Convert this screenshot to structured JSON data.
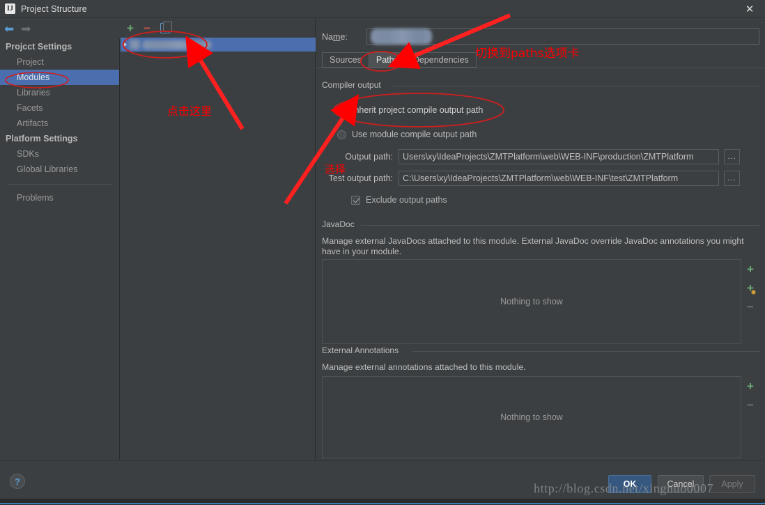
{
  "window": {
    "title": "Project Structure",
    "app_icon": "intellij-idea-icon",
    "close_icon": "close-icon"
  },
  "nav": {
    "back_icon": "arrow-left-icon",
    "forward_icon": "arrow-right-icon"
  },
  "sidebar": {
    "groups": [
      {
        "label": "Projcct Settings",
        "items": [
          {
            "label": "Project",
            "selected": false
          },
          {
            "label": "Modules",
            "selected": true
          },
          {
            "label": "Libraries",
            "selected": false
          },
          {
            "label": "Facets",
            "selected": false
          },
          {
            "label": "Artifacts",
            "selected": false
          }
        ]
      },
      {
        "label": "Platform Settings",
        "items": [
          {
            "label": "SDKs",
            "selected": false
          },
          {
            "label": "Global Libraries",
            "selected": false
          }
        ]
      }
    ],
    "problems": "Problems"
  },
  "modules_panel": {
    "toolbar": {
      "add_icon": "plus-icon",
      "remove_icon": "minus-icon",
      "copy_icon": "copy-icon"
    },
    "selected_row_label": "",
    "selected_row_redacted": true
  },
  "form": {
    "name_label": "Name:",
    "name_value": "",
    "name_redacted": true,
    "tabs": [
      {
        "label": "Sources",
        "active": false
      },
      {
        "label": "Paths",
        "active": true
      },
      {
        "label": "Dependencies",
        "active": false
      }
    ],
    "compiler_output": {
      "group_title": "Compiler output",
      "inherit_option": "Inherit project compile output path",
      "inherit_selected": true,
      "module_option": "Use module compile output path",
      "module_selected": false,
      "output_path_label": "Output path:",
      "output_path_value": "Users\\xy\\IdeaProjects\\ZMTPlatform\\web\\WEB-INF\\production\\ZMTPlatform",
      "test_output_path_label": "Test output path:",
      "test_output_path_value": "C:\\Users\\xy\\IdeaProjects\\ZMTPlatform\\web\\WEB-INF\\test\\ZMTPlatform",
      "browse_label": "...",
      "exclude_label": "Exclude output paths",
      "exclude_checked": true
    },
    "javadoc": {
      "group_title": "JavaDoc",
      "description": "Manage external JavaDocs attached to this module. External JavaDoc override JavaDoc annotations you might have in your module.",
      "empty_text": "Nothing to show",
      "add_icon": "plus-icon",
      "add_url_icon": "plus-with-badge-icon",
      "remove_icon": "minus-icon"
    },
    "external_annotations": {
      "group_title": "External Annotations",
      "description": "Manage external annotations attached to this module.",
      "empty_text": "Nothing to show",
      "add_icon": "plus-icon",
      "remove_icon": "minus-icon"
    }
  },
  "footer": {
    "help_label": "?",
    "ok_label": "OK",
    "cancel_label": "Cancel",
    "apply_label": "Apply",
    "watermark": "http://blog.csdn.net/xinghuo0007"
  },
  "annotations": {
    "click_here": "点击这里",
    "switch_to_paths": "切换到paths选项卡",
    "select": "选择",
    "color": "#ff0000"
  }
}
